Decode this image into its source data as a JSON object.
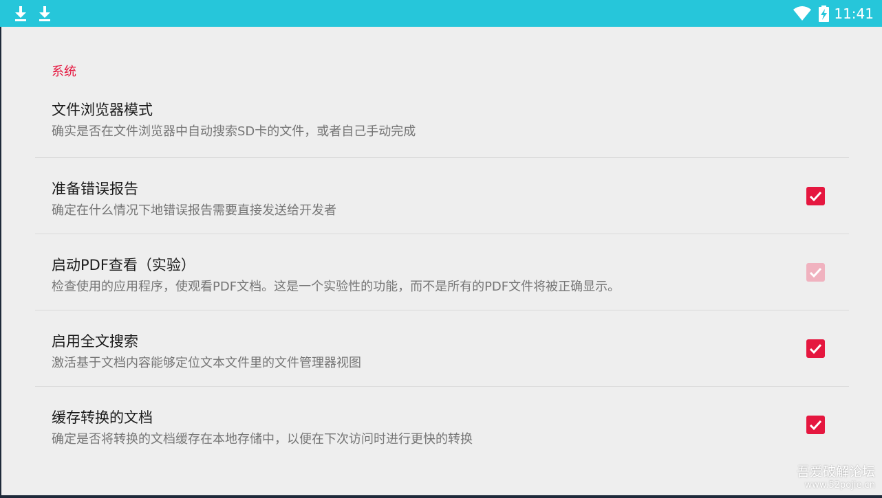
{
  "status_bar": {
    "time": "11:41",
    "left_icons": [
      "download-icon",
      "download-icon"
    ],
    "right_icons": [
      "wifi-icon",
      "battery-charging-icon"
    ],
    "color": "#26c6da"
  },
  "accent_color": "#e5173f",
  "section": {
    "title": "系统"
  },
  "preferences": [
    {
      "title": "文件浏览器模式",
      "summary": "确实是否在文件浏览器中自动搜索SD卡的文件，或者自己手动完成",
      "has_checkbox": false
    },
    {
      "title": "准备错误报告",
      "summary": "确定在什么情况下地错误报告需要直接发送给开发者",
      "has_checkbox": true,
      "checked": true,
      "enabled": true
    },
    {
      "title": "启动PDF查看（实验）",
      "summary": "检查使用的应用程序，使观看PDF文档。这是一个实验性的功能，而不是所有的PDF文件将被正确显示。",
      "has_checkbox": true,
      "checked": true,
      "enabled": false
    },
    {
      "title": "启用全文搜索",
      "summary": "激活基于文档内容能够定位文本文件里的文件管理器视图",
      "has_checkbox": true,
      "checked": true,
      "enabled": true
    },
    {
      "title": "缓存转换的文档",
      "summary": "确定是否将转换的文档缓存在本地存储中，以便在下次访问时进行更快的转换",
      "has_checkbox": true,
      "checked": true,
      "enabled": true
    }
  ],
  "watermark": {
    "title": "吾爱破解论坛",
    "url": "www.52pojie.cn"
  }
}
